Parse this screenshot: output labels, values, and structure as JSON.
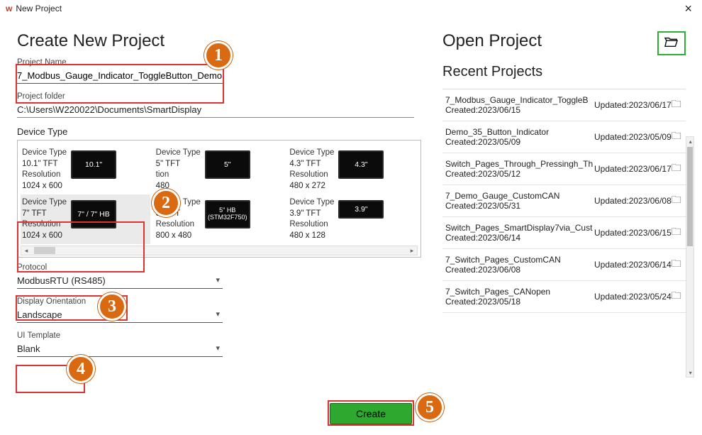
{
  "window": {
    "title": "New Project"
  },
  "left": {
    "heading": "Create New Project",
    "projectName": {
      "label": "Project Name",
      "value": "7_Modbus_Gauge_Indicator_ToggleButton_Demo"
    },
    "projectFolder": {
      "label": "Project folder",
      "value": "C:\\Users\\W220022\\Documents\\SmartDisplay"
    },
    "deviceType": {
      "label": "Device Type",
      "row1": [
        {
          "type": "10.1\" TFT",
          "res": "1024 x 600",
          "thumb": "10.1\""
        },
        {
          "type": "5\" TFT",
          "res": "480",
          "thumb": "5\""
        },
        {
          "type": "4.3\" TFT",
          "res": "480 x 272",
          "thumb": "4.3\""
        }
      ],
      "row2": [
        {
          "type": "7\" TFT",
          "res": "1024 x 600",
          "thumb": "7\" / 7\" HB"
        },
        {
          "type": "5\" TFT",
          "res": "800 x 480",
          "thumb": "5\" HB",
          "sub": "(STM32F750)"
        },
        {
          "type": "3.9\" TFT",
          "res": "480 x 128",
          "thumb": "3.9\""
        }
      ],
      "colLabels": {
        "type": "Device Type",
        "res": "Resolution",
        "restion": "tion"
      }
    },
    "protocol": {
      "label": "Protocol",
      "value": "ModbusRTU (RS485)"
    },
    "orientation": {
      "label": "Display Orientation",
      "value": "Landscape"
    },
    "template": {
      "label": "UI Template",
      "value": "Blank"
    },
    "createLabel": "Create"
  },
  "right": {
    "heading": "Open Project",
    "recentHeading": "Recent Projects",
    "items": [
      {
        "name": "7_Modbus_Gauge_Indicator_ToggleB",
        "created": "Created:2023/06/15",
        "updated": "Updated:2023/06/17"
      },
      {
        "name": "Demo_35_Button_Indicator",
        "created": "Created:2023/05/09",
        "updated": "Updated:2023/05/09"
      },
      {
        "name": "Switch_Pages_Through_Pressingh_Th",
        "created": "Created:2023/05/12",
        "updated": "Updated:2023/06/17"
      },
      {
        "name": "7_Demo_Gauge_CustomCAN",
        "created": "Created:2023/05/31",
        "updated": "Updated:2023/06/08"
      },
      {
        "name": "Switch_Pages_SmartDisplay7via_Cust",
        "created": "Created:2023/06/14",
        "updated": "Updated:2023/06/15"
      },
      {
        "name": "7_Switch_Pages_CustomCAN",
        "created": "Created:2023/06/08",
        "updated": "Updated:2023/06/14"
      },
      {
        "name": "7_Switch_Pages_CANopen",
        "created": "Created:2023/05/18",
        "updated": "Updated:2023/05/24"
      }
    ]
  },
  "callouts": {
    "1": "1",
    "2": "2",
    "3": "3",
    "4": "4",
    "5": "5"
  }
}
